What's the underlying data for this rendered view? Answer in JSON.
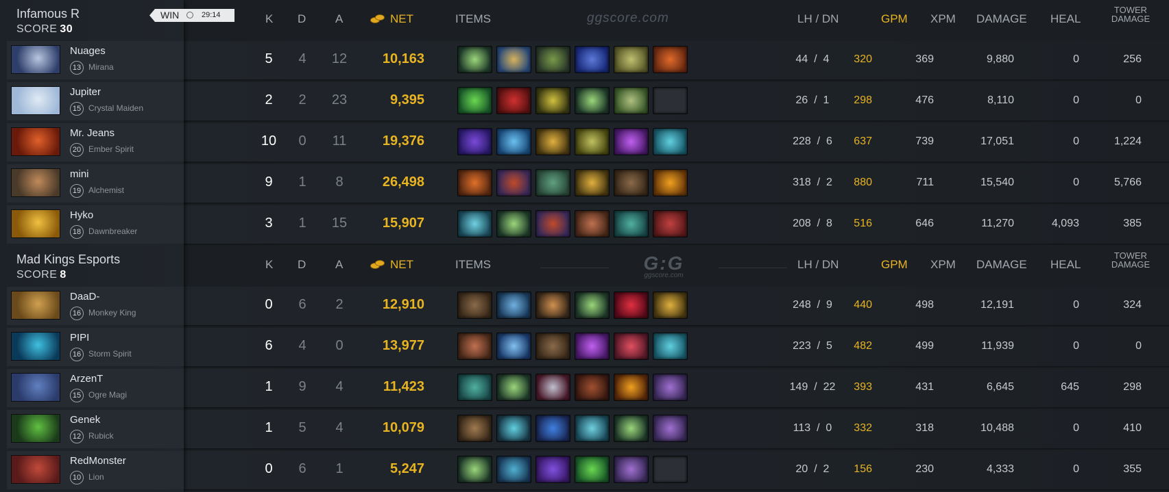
{
  "headers": {
    "k": "K",
    "d": "D",
    "a": "A",
    "net": "NET",
    "items": "ITEMS",
    "lh_dn": "LH  /  DN",
    "gpm": "GPM",
    "xpm": "XPM",
    "damage": "DAMAGE",
    "heal": "HEAL",
    "tower_line1": "TOWER",
    "tower_line2": "DAMAGE"
  },
  "brand": {
    "site": "ggscore.com",
    "logo": "G:G"
  },
  "teams": [
    {
      "name": "Infamous R",
      "score_label": "SCORE",
      "score": "30",
      "result": "WIN",
      "duration": "29:14",
      "players": [
        {
          "name": "Nuages",
          "level": "13",
          "hero": "Mirana",
          "k": "5",
          "d": "4",
          "a": "12",
          "net": "10,163",
          "lh": "44",
          "dn": "4",
          "gpm": "320",
          "xpm": "369",
          "damage": "9,880",
          "heal": "0",
          "tower": "256",
          "avatar": [
            "#2d3e6a",
            "#b9c6e0"
          ],
          "items": [
            [
              "#1f3a2a",
              "#9bd67a"
            ],
            [
              "#2a4a7a",
              "#d7b35c"
            ],
            [
              "#2b3a2a",
              "#7a9a4a"
            ],
            [
              "#1a2a7a",
              "#5b7ad8"
            ],
            [
              "#5a5a2a",
              "#c0c070"
            ],
            [
              "#6a2a12",
              "#e06a2a"
            ]
          ]
        },
        {
          "name": "Jupiter",
          "level": "15",
          "hero": "Crystal Maiden",
          "k": "2",
          "d": "2",
          "a": "23",
          "net": "9,395",
          "lh": "26",
          "dn": "1",
          "gpm": "298",
          "xpm": "476",
          "damage": "8,110",
          "heal": "0",
          "tower": "0",
          "avatar": [
            "#9fb8d8",
            "#e0eaf4"
          ],
          "items": [
            [
              "#1a5a2a",
              "#6ad850"
            ],
            [
              "#5a1212",
              "#d03030"
            ],
            [
              "#3a3a12",
              "#d0c040"
            ],
            [
              "#1f3a2a",
              "#9bd67a"
            ],
            [
              "#3a5a2a",
              "#b0c080"
            ],
            null
          ]
        },
        {
          "name": "Mr. Jeans",
          "level": "20",
          "hero": "Ember Spirit",
          "k": "10",
          "d": "0",
          "a": "11",
          "net": "19,376",
          "lh": "228",
          "dn": "6",
          "gpm": "637",
          "xpm": "739",
          "damage": "17,051",
          "heal": "0",
          "tower": "1,224",
          "avatar": [
            "#6a1a0a",
            "#e0602a"
          ],
          "items": [
            [
              "#2a1a6a",
              "#7a4ad8"
            ],
            [
              "#1a4a7a",
              "#6ac0f0"
            ],
            [
              "#4a3a12",
              "#e0b040"
            ],
            [
              "#4a4a12",
              "#c0c060"
            ],
            [
              "#4a1a6a",
              "#c060f0"
            ],
            [
              "#1a5a6a",
              "#60d0e0"
            ]
          ]
        },
        {
          "name": "mini",
          "level": "19",
          "hero": "Alchemist",
          "k": "9",
          "d": "1",
          "a": "8",
          "net": "26,498",
          "lh": "318",
          "dn": "2",
          "gpm": "880",
          "xpm": "711",
          "damage": "15,540",
          "heal": "0",
          "tower": "5,766",
          "avatar": [
            "#4a3a2a",
            "#c08a5a"
          ],
          "items": [
            [
              "#5a2a12",
              "#e0702a"
            ],
            [
              "#3a2a5a",
              "#c04a2a"
            ],
            [
              "#2a4a3a",
              "#60a080"
            ],
            [
              "#4a3a12",
              "#e0b040"
            ],
            [
              "#3a2a1a",
              "#8a6a4a"
            ],
            [
              "#6a3a0a",
              "#f0a020"
            ]
          ]
        },
        {
          "name": "Hyko",
          "level": "18",
          "hero": "Dawnbreaker",
          "k": "3",
          "d": "1",
          "a": "15",
          "net": "15,907",
          "lh": "208",
          "dn": "8",
          "gpm": "516",
          "xpm": "646",
          "damage": "11,270",
          "heal": "4,093",
          "tower": "385",
          "avatar": [
            "#8a5a0a",
            "#f0c040"
          ],
          "items": [
            [
              "#1a4a5a",
              "#70d0e0"
            ],
            [
              "#1f3a2a",
              "#9bd67a"
            ],
            [
              "#3a2a5a",
              "#c04a2a"
            ],
            [
              "#4a2a1a",
              "#c07050"
            ],
            [
              "#1a4a4a",
              "#50b0a0"
            ],
            [
              "#5a1a1a",
              "#c04040"
            ]
          ]
        }
      ]
    },
    {
      "name": "Mad Kings Esports",
      "score_label": "SCORE",
      "score": "8",
      "players": [
        {
          "name": "DaaD-",
          "level": "16",
          "hero": "Monkey King",
          "k": "0",
          "d": "6",
          "a": "2",
          "net": "12,910",
          "lh": "248",
          "dn": "9",
          "gpm": "440",
          "xpm": "498",
          "damage": "12,191",
          "heal": "0",
          "tower": "324",
          "avatar": [
            "#6a4a1a",
            "#d0a050"
          ],
          "items": [
            [
              "#3a2a1a",
              "#8a6a4a"
            ],
            [
              "#1a3a5a",
              "#70b0e0"
            ],
            [
              "#3a2a1a",
              "#d09050"
            ],
            [
              "#1f3a2a",
              "#9bd67a"
            ],
            [
              "#5a0a1a",
              "#e03040"
            ],
            [
              "#4a3a12",
              "#e0b040"
            ]
          ]
        },
        {
          "name": "PIPI",
          "level": "16",
          "hero": "Storm Spirit",
          "k": "6",
          "d": "4",
          "a": "0",
          "net": "13,977",
          "lh": "223",
          "dn": "5",
          "gpm": "482",
          "xpm": "499",
          "damage": "11,939",
          "heal": "0",
          "tower": "0",
          "avatar": [
            "#0a3a5a",
            "#40c0e0"
          ],
          "items": [
            [
              "#4a2a1a",
              "#c07050"
            ],
            [
              "#1a3a6a",
              "#80c0f0"
            ],
            [
              "#3a2a1a",
              "#8a6a4a"
            ],
            [
              "#4a1a6a",
              "#c060f0"
            ],
            [
              "#5a1a2a",
              "#e05060"
            ],
            [
              "#1a5a6a",
              "#60d0e0"
            ]
          ]
        },
        {
          "name": "ArzenT",
          "level": "15",
          "hero": "Ogre Magi",
          "k": "1",
          "d": "9",
          "a": "4",
          "net": "11,423",
          "lh": "149",
          "dn": "22",
          "gpm": "393",
          "xpm": "431",
          "damage": "6,645",
          "heal": "645",
          "tower": "298",
          "avatar": [
            "#2a3a6a",
            "#6080c0"
          ],
          "items": [
            [
              "#1a4a4a",
              "#50b0a0"
            ],
            [
              "#1f3a2a",
              "#9bd67a"
            ],
            [
              "#4a1a2a",
              "#c0c0d0"
            ],
            [
              "#3a1a12",
              "#a05030"
            ],
            [
              "#5a2a0a",
              "#f0a020"
            ],
            [
              "#3a2a5a",
              "#a070d0"
            ]
          ]
        },
        {
          "name": "Genek",
          "level": "12",
          "hero": "Rubick",
          "k": "1",
          "d": "5",
          "a": "4",
          "net": "10,079",
          "lh": "113",
          "dn": "0",
          "gpm": "332",
          "xpm": "318",
          "damage": "10,488",
          "heal": "0",
          "tower": "410",
          "avatar": [
            "#1a3a1a",
            "#60c040"
          ],
          "items": [
            [
              "#3a2a1a",
              "#a07a50"
            ],
            [
              "#1a3a4a",
              "#60d0e0"
            ],
            [
              "#1a2a5a",
              "#4080e0"
            ],
            [
              "#1a4a5a",
              "#70d0e0"
            ],
            [
              "#1f3a2a",
              "#9bd67a"
            ],
            [
              "#3a2a5a",
              "#a070d0"
            ]
          ]
        },
        {
          "name": "RedMonster",
          "level": "10",
          "hero": "Lion",
          "k": "0",
          "d": "6",
          "a": "1",
          "net": "5,247",
          "lh": "20",
          "dn": "2",
          "gpm": "156",
          "xpm": "230",
          "damage": "4,333",
          "heal": "0",
          "tower": "355",
          "avatar": [
            "#5a1a1a",
            "#c04a3a"
          ],
          "items": [
            [
              "#1f3a2a",
              "#9bd67a"
            ],
            [
              "#1a3a5a",
              "#50b0d0"
            ],
            [
              "#3a1a6a",
              "#8050e0"
            ],
            [
              "#1a5a2a",
              "#6ad850"
            ],
            [
              "#3a2a5a",
              "#a070d0"
            ],
            null
          ]
        }
      ]
    }
  ]
}
